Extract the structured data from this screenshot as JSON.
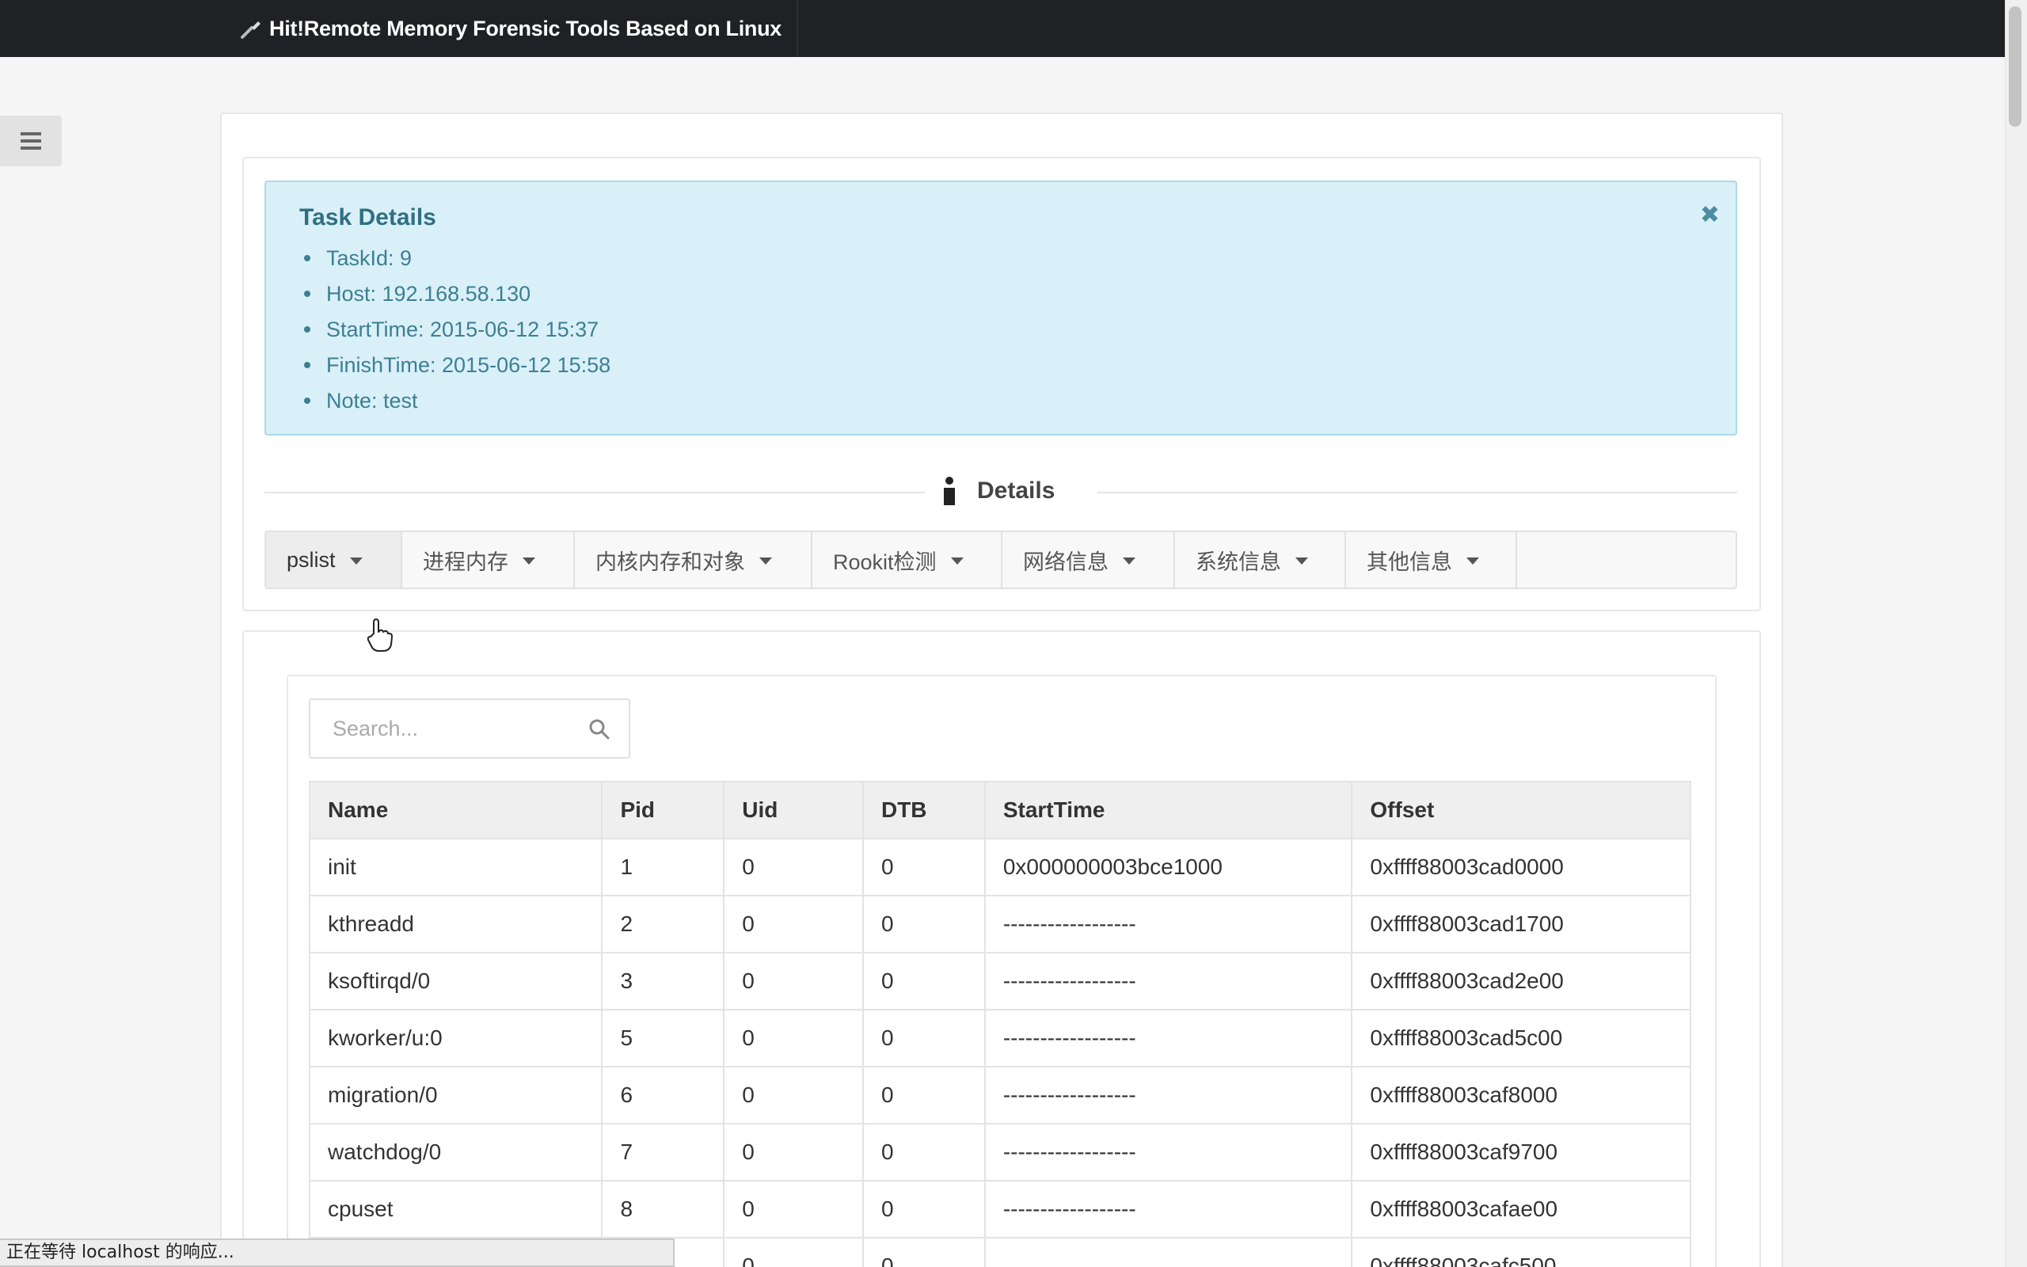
{
  "app": {
    "title": "Hit!Remote Memory Forensic Tools Based on Linux"
  },
  "task_details": {
    "title": "Task Details",
    "close_symbol": "✖",
    "items": [
      "TaskId: 9",
      "Host: 192.168.58.130",
      "StartTime: 2015-06-12 15:37",
      "FinishTime: 2015-06-12 15:58",
      "Note: test"
    ]
  },
  "details_divider": {
    "label": "Details"
  },
  "tabs": [
    {
      "label": "pslist"
    },
    {
      "label": "进程内存"
    },
    {
      "label": "内核内存和对象"
    },
    {
      "label": "Rookit检测"
    },
    {
      "label": "网络信息"
    },
    {
      "label": "系统信息"
    },
    {
      "label": "其他信息"
    }
  ],
  "search": {
    "placeholder": "Search..."
  },
  "table": {
    "headers": [
      "Name",
      "Pid",
      "Uid",
      "DTB",
      "StartTime",
      "Offset"
    ],
    "rows": [
      [
        "init",
        "1",
        "0",
        "0",
        "0x000000003bce1000",
        "0xffff88003cad0000"
      ],
      [
        "kthreadd",
        "2",
        "0",
        "0",
        "------------------",
        "0xffff88003cad1700"
      ],
      [
        "ksoftirqd/0",
        "3",
        "0",
        "0",
        "------------------",
        "0xffff88003cad2e00"
      ],
      [
        "kworker/u:0",
        "5",
        "0",
        "0",
        "------------------",
        "0xffff88003cad5c00"
      ],
      [
        "migration/0",
        "6",
        "0",
        "0",
        "------------------",
        "0xffff88003caf8000"
      ],
      [
        "watchdog/0",
        "7",
        "0",
        "0",
        "------------------",
        "0xffff88003caf9700"
      ],
      [
        "cpuset",
        "8",
        "0",
        "0",
        "------------------",
        "0xffff88003cafae00"
      ],
      [
        "",
        "",
        "0",
        "0",
        "",
        "0xffff88003cafc500"
      ]
    ]
  },
  "statusbar": {
    "text": "正在等待 localhost 的响应..."
  },
  "icons": {
    "brand": "wrench-icon",
    "menu": "hamburger-menu-icon",
    "info": "info-icon",
    "search": "search-icon",
    "close": "close-icon",
    "cursor": "hand-pointer-icon"
  },
  "colors": {
    "topbar": "#1f2124",
    "alert_bg": "#d9f0f8",
    "alert_text": "#3d7f92"
  }
}
